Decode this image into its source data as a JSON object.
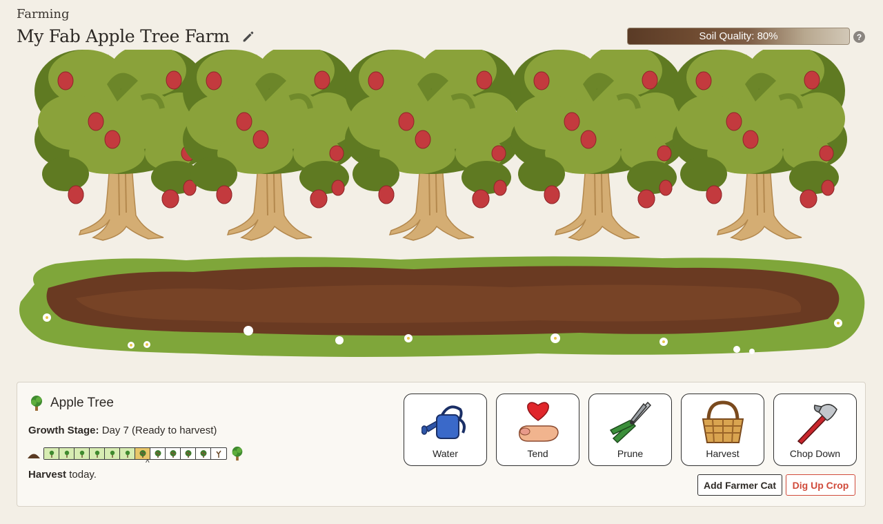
{
  "breadcrumb": "Farming",
  "farm": {
    "title": "My Fab Apple Tree Farm"
  },
  "soil": {
    "label": "Soil Quality: 80%",
    "value": 0.8
  },
  "crop": {
    "name": "Apple Tree",
    "growth_label": "Growth Stage:",
    "growth_value": "Day 7 (Ready to harvest)",
    "harvest_label": "Harvest",
    "harvest_text": "today.",
    "stages_total": 12,
    "current_stage": 7
  },
  "actions": {
    "water": "Water",
    "tend": "Tend",
    "prune": "Prune",
    "harvest": "Harvest",
    "chop": "Chop Down"
  },
  "buttons": {
    "add_cat": "Add Farmer Cat",
    "dig_up": "Dig Up Crop"
  },
  "help_glyph": "?",
  "caret_glyph": "^",
  "colors": {
    "leaf": "#8aa23a",
    "leaf_dark": "#5f7a22",
    "apple": "#c33a3e",
    "trunk": "#d4ad73",
    "soil": "#6a3a22",
    "grass": "#7fa63a",
    "danger": "#d04a3a"
  }
}
